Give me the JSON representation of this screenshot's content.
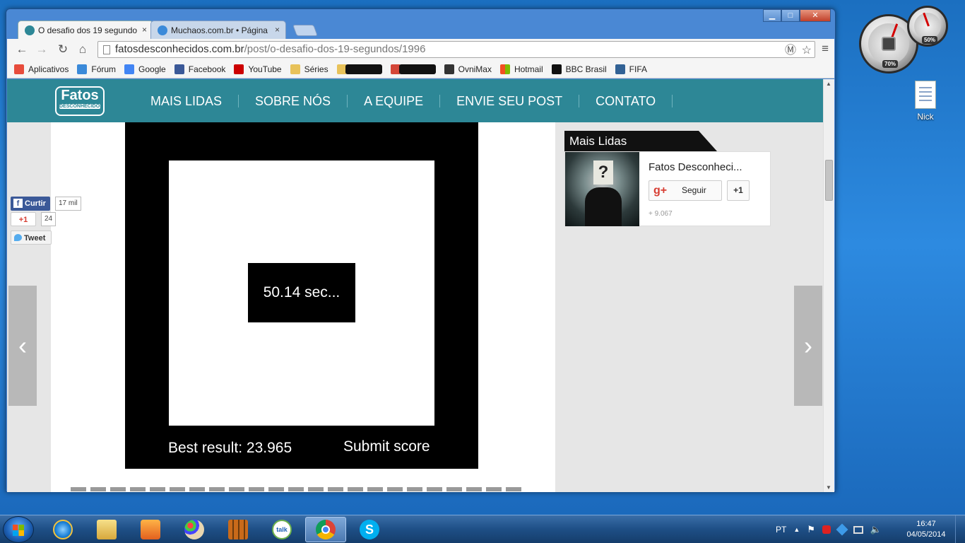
{
  "desktop": {
    "gadgets": {
      "cpu_readout": "70%",
      "ram_readout": "50%"
    },
    "icons": [
      {
        "label": "Nick"
      }
    ]
  },
  "browser": {
    "tabs": [
      {
        "title": "O desafio dos 19 segundo",
        "close": "×",
        "active": true
      },
      {
        "title": "Muchaos.com.br • Página",
        "close": "×",
        "active": false
      }
    ],
    "window_controls": {
      "minimize": "▁",
      "maximize": "□",
      "close": "✕"
    },
    "nav": {
      "back": "←",
      "forward": "→",
      "reload": "↻",
      "home": "⌂",
      "menu": "≡",
      "star": "☆",
      "ext": "Ⓜ"
    },
    "address": {
      "domain": "fatosdesconhecidos.com.br",
      "path": "/post/o-desafio-dos-19-segundos/1996"
    },
    "bookmarks": [
      {
        "label": "Aplicativos",
        "color": "#e74c3c"
      },
      {
        "label": "Fórum",
        "color": "#3b8ad9"
      },
      {
        "label": "Google",
        "color": "#4285f4"
      },
      {
        "label": "Facebook",
        "color": "#3b5998"
      },
      {
        "label": "YouTube",
        "color": "#cc0000"
      },
      {
        "label": "Séries",
        "color": "#e8c25a"
      },
      {
        "label": "OvniMax",
        "color": "#333333"
      },
      {
        "label": "Hotmail",
        "color": "#f25022"
      },
      {
        "label": "BBC Brasil",
        "color": "#111111"
      },
      {
        "label": "FIFA",
        "color": "#326295"
      }
    ]
  },
  "site": {
    "logo_top": "Fatos",
    "logo_bottom": "DESCONHECIDOS",
    "nav": [
      "MAIS LIDAS",
      "SOBRE NÓS",
      "A EQUIPE",
      "ENVIE SEU POST",
      "CONTATO"
    ],
    "game": {
      "timer": "50.14 sec...",
      "best_label": "Best result:",
      "best_value": "23.965",
      "submit": "Submit score"
    },
    "social": {
      "facebook_label": "Curtir",
      "facebook_count": "17 mil",
      "gplus_label": "+1",
      "gplus_count": "24",
      "tweet_label": "Tweet"
    },
    "arrows": {
      "prev": "‹",
      "next": "›"
    },
    "sidebar": {
      "heading": "Mais Lidas",
      "page_name": "Fatos Desconheci...",
      "follow_label": "Seguir",
      "plusone_label": "+1",
      "followers": "+ 9.067"
    }
  },
  "taskbar": {
    "language": "PT",
    "time": "16:47",
    "date": "04/05/2014"
  }
}
